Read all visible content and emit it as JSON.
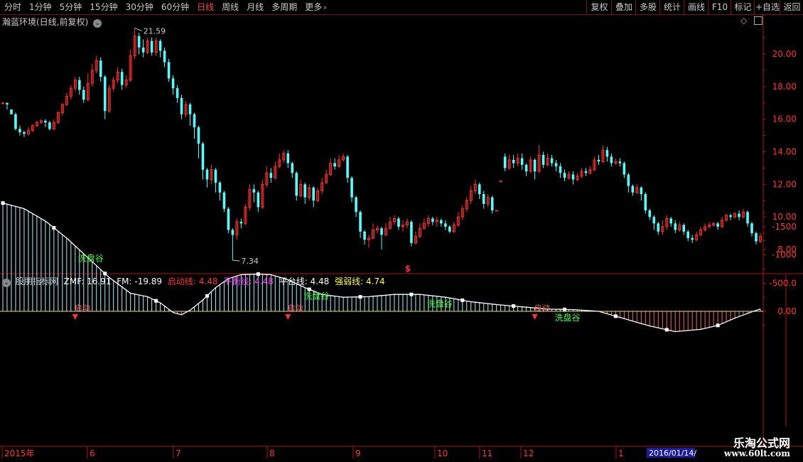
{
  "toolbar": {
    "periods": [
      "分时",
      "1分钟",
      "5分钟",
      "15分钟",
      "30分钟",
      "60分钟",
      "日线",
      "周线",
      "月线",
      "多周期",
      "更多"
    ],
    "active_period": "日线",
    "right_buttons": [
      "复权",
      "叠加",
      "多股",
      "统计",
      "画线",
      "F10",
      "标记",
      "+自选",
      "返回"
    ]
  },
  "main_panel": {
    "title": "瀚蓝环境(日线,前复权)",
    "high_label": "21.59",
    "low_label": "7.34",
    "signal_mark": "$",
    "y_ticks": [
      "20.00",
      "18.00",
      "16.00",
      "14.00",
      "12.00",
      "10.00",
      "8.00"
    ]
  },
  "indicator_panel": {
    "name": "股朋指标网",
    "zmf_label": "ZMF: 16.91",
    "fm_label": "FM: -19.89",
    "qidong_label": "启动线: 4.48",
    "pingheng_label": "平衡线: 4.48",
    "pingtai_label": "平台线: 4.48",
    "qiangruo_label": "强弱线: 4.74",
    "y_ticks": [
      "0.00",
      "-500.0",
      "-1000",
      "-1500"
    ],
    "qidong_text": "启动",
    "xiandang_text": "洗盘谷"
  },
  "timeline": {
    "labels": [
      "2015年",
      "6",
      "7",
      "8",
      "9",
      "10",
      "11",
      "12",
      "1"
    ],
    "cursor_date": "2016/01/14/"
  },
  "watermark": {
    "line1": "乐淘公式网",
    "line2": "www.60lt.com"
  },
  "colors": {
    "up": "#ff3030",
    "down": "#54ffff",
    "axis": "#b01010",
    "zmf_line": "#ffffff",
    "qidong": "#ff3030",
    "pingheng": "#ff40ff",
    "pingtai": "#ffffff",
    "qiangruo": "#ffff40",
    "xiandang": "#40ff40"
  },
  "chart_data": {
    "type": "candlestick",
    "price_ylim": [
      7.0,
      22.5
    ],
    "indicator_ylim": [
      -2000,
      500
    ],
    "candles": [
      [
        17.0,
        17.0,
        16.9,
        17.0
      ],
      [
        17.0,
        16.9,
        16.6,
        17.0
      ],
      [
        16.6,
        16.3,
        16.3,
        16.6
      ],
      [
        16.3,
        15.4,
        15.3,
        16.4
      ],
      [
        15.4,
        15.2,
        15.0,
        15.6
      ],
      [
        15.2,
        15.1,
        14.9,
        15.3
      ],
      [
        15.1,
        15.3,
        15.0,
        15.5
      ],
      [
        15.3,
        15.6,
        15.2,
        15.7
      ],
      [
        15.6,
        15.8,
        15.5,
        15.9
      ],
      [
        15.8,
        15.9,
        15.7,
        16.0
      ],
      [
        15.9,
        15.8,
        15.5,
        16.0
      ],
      [
        15.8,
        15.4,
        15.3,
        15.9
      ],
      [
        15.4,
        15.8,
        15.3,
        16.0
      ],
      [
        15.8,
        16.4,
        15.7,
        16.5
      ],
      [
        16.4,
        16.9,
        16.2,
        17.0
      ],
      [
        16.9,
        17.4,
        16.8,
        17.6
      ],
      [
        17.4,
        17.9,
        17.2,
        18.1
      ],
      [
        17.9,
        18.4,
        17.7,
        18.6
      ],
      [
        18.4,
        17.8,
        17.5,
        18.6
      ],
      [
        17.8,
        17.2,
        17.0,
        18.0
      ],
      [
        17.2,
        18.2,
        17.1,
        18.8
      ],
      [
        18.2,
        19.0,
        18.0,
        19.4
      ],
      [
        19.0,
        19.6,
        18.8,
        19.9
      ],
      [
        19.6,
        18.6,
        18.3,
        19.8
      ],
      [
        18.6,
        16.5,
        16.0,
        18.7
      ],
      [
        16.5,
        17.9,
        16.4,
        18.1
      ],
      [
        17.9,
        18.4,
        17.7,
        18.6
      ],
      [
        18.4,
        18.9,
        18.2,
        19.2
      ],
      [
        18.9,
        18.1,
        17.8,
        19.1
      ],
      [
        18.1,
        18.4,
        17.9,
        18.7
      ],
      [
        18.4,
        19.9,
        18.3,
        20.3
      ],
      [
        19.9,
        21.1,
        19.7,
        21.59
      ],
      [
        21.1,
        20.4,
        20.0,
        21.3
      ],
      [
        20.4,
        20.1,
        19.8,
        20.9
      ],
      [
        20.1,
        20.8,
        20.0,
        21.0
      ],
      [
        20.8,
        20.1,
        19.9,
        21.0
      ],
      [
        20.1,
        20.8,
        19.9,
        21.0
      ],
      [
        20.8,
        20.2,
        19.8,
        20.9
      ],
      [
        20.2,
        19.5,
        19.2,
        20.4
      ],
      [
        19.5,
        18.5,
        18.3,
        19.7
      ],
      [
        18.5,
        17.9,
        17.5,
        18.7
      ],
      [
        17.9,
        17.3,
        17.0,
        18.1
      ],
      [
        17.3,
        16.3,
        16.0,
        17.5
      ],
      [
        16.3,
        16.9,
        16.1,
        17.1
      ],
      [
        16.9,
        16.3,
        15.6,
        17.0
      ],
      [
        16.3,
        15.5,
        14.8,
        16.4
      ],
      [
        15.5,
        14.5,
        13.6,
        15.6
      ],
      [
        14.5,
        12.9,
        12.3,
        14.6
      ],
      [
        12.9,
        12.3,
        11.8,
        13.0
      ],
      [
        12.3,
        12.9,
        12.0,
        13.2
      ],
      [
        12.9,
        12.1,
        11.5,
        13.0
      ],
      [
        12.1,
        11.5,
        11.0,
        12.2
      ],
      [
        11.5,
        10.5,
        10.3,
        11.6
      ],
      [
        10.5,
        9.2,
        9.0,
        10.6
      ],
      [
        9.2,
        8.9,
        7.34,
        9.3
      ],
      [
        8.9,
        9.7,
        8.6,
        9.9
      ],
      [
        9.7,
        9.6,
        9.3,
        9.9
      ],
      [
        9.6,
        10.6,
        9.5,
        10.8
      ],
      [
        10.6,
        11.7,
        10.4,
        12.0
      ],
      [
        11.7,
        11.5,
        10.9,
        12.0
      ],
      [
        11.5,
        10.6,
        10.3,
        11.6
      ],
      [
        10.6,
        12.0,
        10.5,
        12.3
      ],
      [
        12.0,
        12.7,
        11.8,
        13.1
      ],
      [
        12.7,
        12.4,
        12.1,
        13.0
      ],
      [
        12.4,
        13.1,
        12.3,
        13.4
      ],
      [
        13.1,
        13.5,
        13.0,
        13.9
      ],
      [
        13.5,
        13.9,
        13.3,
        14.1
      ],
      [
        13.9,
        13.3,
        13.0,
        14.1
      ],
      [
        13.3,
        12.7,
        12.4,
        13.4
      ],
      [
        12.7,
        11.3,
        11.0,
        12.8
      ],
      [
        11.3,
        12.0,
        11.2,
        12.3
      ],
      [
        12.0,
        11.2,
        10.8,
        12.1
      ],
      [
        11.2,
        11.8,
        11.0,
        12.0
      ],
      [
        11.8,
        11.0,
        10.6,
        11.9
      ],
      [
        11.0,
        11.6,
        10.9,
        11.8
      ],
      [
        11.6,
        12.1,
        11.4,
        12.4
      ],
      [
        12.1,
        12.6,
        12.0,
        12.9
      ],
      [
        12.6,
        13.3,
        12.5,
        13.6
      ],
      [
        13.3,
        13.1,
        12.9,
        13.6
      ],
      [
        13.1,
        13.5,
        13.0,
        13.8
      ],
      [
        13.5,
        13.7,
        13.4,
        13.9
      ],
      [
        13.7,
        12.4,
        12.1,
        13.8
      ],
      [
        12.4,
        11.2,
        10.9,
        12.5
      ],
      [
        11.2,
        10.3,
        10.0,
        11.3
      ],
      [
        10.3,
        9.1,
        8.7,
        10.4
      ],
      [
        9.1,
        8.6,
        8.3,
        9.2
      ],
      [
        8.6,
        8.7,
        8.1,
        8.9
      ],
      [
        8.7,
        9.2,
        8.6,
        9.6
      ],
      [
        9.2,
        9.3,
        9.0,
        9.5
      ],
      [
        9.3,
        8.9,
        8.0,
        9.4
      ],
      [
        8.9,
        9.3,
        8.8,
        9.6
      ],
      [
        9.3,
        9.7,
        9.2,
        10.0
      ],
      [
        9.7,
        9.9,
        9.5,
        10.1
      ],
      [
        9.9,
        9.4,
        9.2,
        10.0
      ],
      [
        9.4,
        9.5,
        9.1,
        9.8
      ],
      [
        9.5,
        9.7,
        9.3,
        9.9
      ],
      [
        9.7,
        8.4,
        8.2,
        9.8
      ],
      [
        8.4,
        8.8,
        8.3,
        9.1
      ],
      [
        8.8,
        9.3,
        8.7,
        9.6
      ],
      [
        9.3,
        9.6,
        9.2,
        9.9
      ],
      [
        9.6,
        9.9,
        9.4,
        10.1
      ],
      [
        9.9,
        9.7,
        9.5,
        10.0
      ],
      [
        9.7,
        9.8,
        9.4,
        10.0
      ],
      [
        9.8,
        9.6,
        9.4,
        9.9
      ],
      [
        9.6,
        9.4,
        9.2,
        9.8
      ],
      [
        9.4,
        9.1,
        9.0,
        9.5
      ],
      [
        9.1,
        9.5,
        9.0,
        9.7
      ],
      [
        9.5,
        10.0,
        9.4,
        10.3
      ],
      [
        10.0,
        10.5,
        9.8,
        10.7
      ],
      [
        10.5,
        11.0,
        10.3,
        11.2
      ],
      [
        11.0,
        11.6,
        10.8,
        11.9
      ],
      [
        11.6,
        12.0,
        11.4,
        12.3
      ],
      [
        12.0,
        11.4,
        11.1,
        12.1
      ],
      [
        11.4,
        10.8,
        10.5,
        11.6
      ],
      [
        10.8,
        11.2,
        10.6,
        11.4
      ],
      [
        11.2,
        10.4,
        10.2,
        11.3
      ],
      [
        10.4,
        10.4,
        10.4,
        10.4
      ],
      [
        12.2,
        12.2,
        12.2,
        12.2
      ],
      [
        13.7,
        13.0,
        12.8,
        13.9
      ],
      [
        13.0,
        13.5,
        12.9,
        13.8
      ],
      [
        13.5,
        13.3,
        13.0,
        13.8
      ],
      [
        13.3,
        13.6,
        13.1,
        13.9
      ],
      [
        13.6,
        13.2,
        12.9,
        13.9
      ],
      [
        13.2,
        12.8,
        12.5,
        13.3
      ],
      [
        12.8,
        13.5,
        12.7,
        13.7
      ],
      [
        13.5,
        12.8,
        12.3,
        13.6
      ],
      [
        12.8,
        13.8,
        12.7,
        14.4
      ],
      [
        13.8,
        13.2,
        13.0,
        14.0
      ],
      [
        13.2,
        13.6,
        13.1,
        13.9
      ],
      [
        13.6,
        13.3,
        13.1,
        13.8
      ],
      [
        13.3,
        13.1,
        12.8,
        13.5
      ],
      [
        13.1,
        12.7,
        12.4,
        13.3
      ],
      [
        12.7,
        12.4,
        12.2,
        12.9
      ],
      [
        12.4,
        12.6,
        12.3,
        12.8
      ],
      [
        12.6,
        12.3,
        12.0,
        12.8
      ],
      [
        12.3,
        12.5,
        12.2,
        12.7
      ],
      [
        12.5,
        12.8,
        12.4,
        13.0
      ],
      [
        12.8,
        12.7,
        12.5,
        13.0
      ],
      [
        12.7,
        12.9,
        12.6,
        13.1
      ],
      [
        12.9,
        13.5,
        12.8,
        13.7
      ],
      [
        13.5,
        13.4,
        13.2,
        13.8
      ],
      [
        13.4,
        14.1,
        13.3,
        14.4
      ],
      [
        14.1,
        13.7,
        13.4,
        14.3
      ],
      [
        13.7,
        13.3,
        13.1,
        13.9
      ],
      [
        13.3,
        13.4,
        13.2,
        13.6
      ],
      [
        13.4,
        13.3,
        13.1,
        13.6
      ],
      [
        13.3,
        12.6,
        12.4,
        13.4
      ],
      [
        12.6,
        11.9,
        11.5,
        12.7
      ],
      [
        11.9,
        11.5,
        11.3,
        12.0
      ],
      [
        11.5,
        11.8,
        11.4,
        12.0
      ],
      [
        11.8,
        11.4,
        11.0,
        11.9
      ],
      [
        11.4,
        10.4,
        10.2,
        11.5
      ],
      [
        10.4,
        10.0,
        9.8,
        10.5
      ],
      [
        10.0,
        9.6,
        9.2,
        10.1
      ],
      [
        9.6,
        9.1,
        8.9,
        9.7
      ],
      [
        9.1,
        9.4,
        8.9,
        9.8
      ],
      [
        9.4,
        9.9,
        9.2,
        10.1
      ],
      [
        9.9,
        9.6,
        9.4,
        10.0
      ],
      [
        9.6,
        9.2,
        9.0,
        9.8
      ],
      [
        9.2,
        9.5,
        9.1,
        9.7
      ],
      [
        9.5,
        9.1,
        8.9,
        9.6
      ],
      [
        9.1,
        8.7,
        8.5,
        9.2
      ],
      [
        8.7,
        8.6,
        8.4,
        8.9
      ],
      [
        8.6,
        8.9,
        8.5,
        9.1
      ],
      [
        8.9,
        9.2,
        8.8,
        9.4
      ],
      [
        9.2,
        9.4,
        9.1,
        9.6
      ],
      [
        9.4,
        9.5,
        9.3,
        9.7
      ],
      [
        9.5,
        9.6,
        9.4,
        9.7
      ],
      [
        9.6,
        9.4,
        9.2,
        9.7
      ],
      [
        9.4,
        9.8,
        9.3,
        10.0
      ],
      [
        9.8,
        10.1,
        9.7,
        10.2
      ],
      [
        10.1,
        10.0,
        9.8,
        10.2
      ],
      [
        10.0,
        10.2,
        9.9,
        10.3
      ],
      [
        10.2,
        10.0,
        9.8,
        10.4
      ],
      [
        10.0,
        10.3,
        9.9,
        10.5
      ],
      [
        10.3,
        9.6,
        9.4,
        10.4
      ],
      [
        9.6,
        9.0,
        8.8,
        9.7
      ],
      [
        9.0,
        8.5,
        8.3,
        9.1
      ],
      [
        8.5,
        8.8,
        8.4,
        9.0
      ]
    ],
    "zmf_curve": [
      [
        0,
        -1920
      ],
      [
        5,
        -1820
      ],
      [
        10,
        -1600
      ],
      [
        15,
        -1300
      ],
      [
        20,
        -950
      ],
      [
        25,
        -600
      ],
      [
        30,
        -320
      ],
      [
        34,
        -260
      ],
      [
        37,
        -150
      ],
      [
        40,
        20
      ],
      [
        42,
        60
      ],
      [
        44,
        -20
      ],
      [
        47,
        -200
      ],
      [
        50,
        -420
      ],
      [
        53,
        -580
      ],
      [
        56,
        -650
      ],
      [
        60,
        -660
      ],
      [
        63,
        -650
      ],
      [
        67,
        -560
      ],
      [
        71,
        -420
      ],
      [
        75,
        -300
      ],
      [
        80,
        -250
      ],
      [
        86,
        -260
      ],
      [
        92,
        -300
      ],
      [
        98,
        -300
      ],
      [
        104,
        -250
      ],
      [
        110,
        -170
      ],
      [
        116,
        -120
      ],
      [
        122,
        -80
      ],
      [
        128,
        -40
      ],
      [
        134,
        -30
      ],
      [
        140,
        0
      ],
      [
        146,
        130
      ],
      [
        152,
        260
      ],
      [
        158,
        360
      ],
      [
        164,
        320
      ],
      [
        168,
        250
      ],
      [
        172,
        120
      ],
      [
        176,
        10
      ],
      [
        180,
        -90
      ],
      [
        184,
        -70
      ],
      [
        188,
        -20
      ],
      [
        192,
        -10
      ],
      [
        196,
        -60
      ],
      [
        200,
        -120
      ],
      [
        205,
        -140
      ],
      [
        210,
        -140
      ],
      [
        215,
        -150
      ],
      [
        220,
        -140
      ],
      [
        226,
        -120
      ],
      [
        232,
        -90
      ],
      [
        238,
        -40
      ],
      [
        243,
        -10
      ]
    ],
    "qidong_x": [
      17,
      67,
      125,
      196,
      242
    ],
    "xiandang_x": [
      18,
      71,
      100,
      130,
      193,
      238
    ]
  }
}
